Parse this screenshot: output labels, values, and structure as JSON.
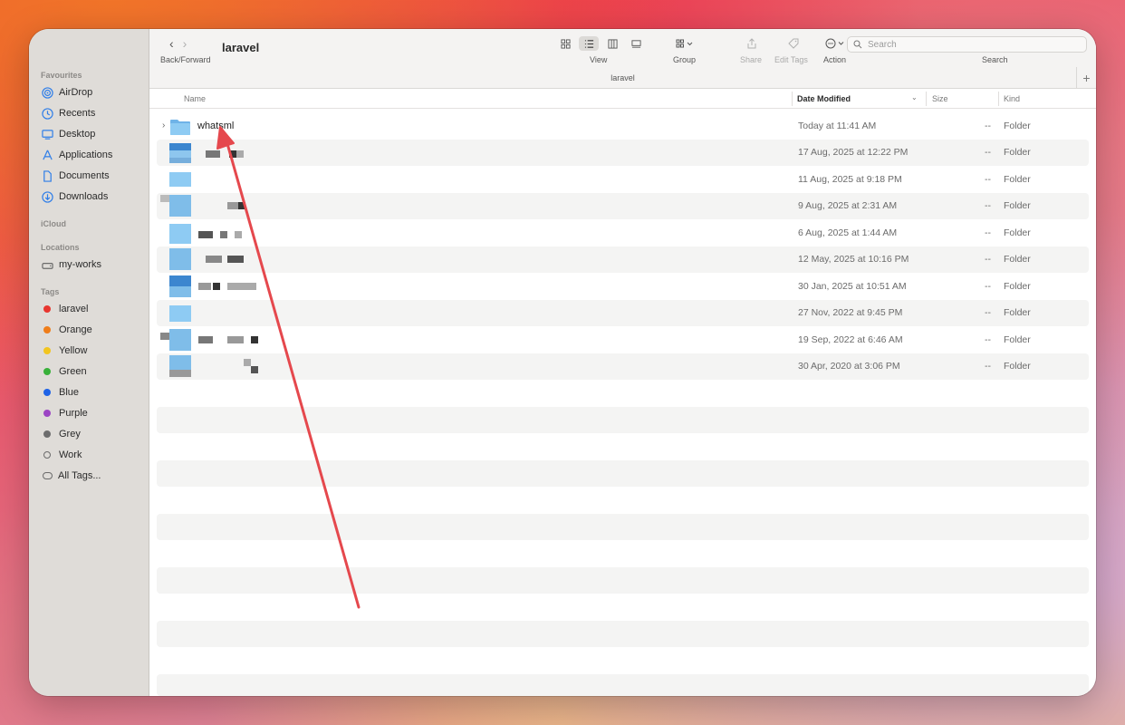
{
  "window": {
    "title": "laravel",
    "path_title": "laravel"
  },
  "toolbar": {
    "back_forward_label": "Back/Forward",
    "view_label": "View",
    "group_label": "Group",
    "share_label": "Share",
    "edit_tags_label": "Edit Tags",
    "action_label": "Action",
    "search_label": "Search",
    "search_placeholder": "Search",
    "add_tab": "+"
  },
  "sidebar": {
    "favourites_heading": "Favourites",
    "favourites": [
      {
        "label": "AirDrop",
        "icon": "airdrop-icon"
      },
      {
        "label": "Recents",
        "icon": "clock-icon"
      },
      {
        "label": "Desktop",
        "icon": "desktop-icon"
      },
      {
        "label": "Applications",
        "icon": "applications-icon"
      },
      {
        "label": "Documents",
        "icon": "document-icon"
      },
      {
        "label": "Downloads",
        "icon": "download-icon"
      }
    ],
    "icloud_heading": "iCloud",
    "locations_heading": "Locations",
    "locations": [
      {
        "label": "my-works",
        "icon": "drive-icon"
      }
    ],
    "tags_heading": "Tags",
    "tags": [
      {
        "label": "laravel",
        "color": "#e8362f"
      },
      {
        "label": "Orange",
        "color": "#ef7d1a"
      },
      {
        "label": "Yellow",
        "color": "#f2c51f"
      },
      {
        "label": "Green",
        "color": "#39b13a"
      },
      {
        "label": "Blue",
        "color": "#1f63e6"
      },
      {
        "label": "Purple",
        "color": "#9c45c4"
      },
      {
        "label": "Grey",
        "color": "#6d6d6d"
      },
      {
        "label": "Work",
        "color": "ring"
      },
      {
        "label": "All Tags...",
        "color": "pill"
      }
    ]
  },
  "columns": {
    "name": "Name",
    "date_modified": "Date Modified",
    "size": "Size",
    "kind": "Kind"
  },
  "files": [
    {
      "name": "whatsml",
      "date": "Today at 11:41 AM",
      "size": "--",
      "kind": "Folder"
    },
    {
      "name": "",
      "date": "17 Aug, 2025 at 12:22 PM",
      "size": "--",
      "kind": "Folder"
    },
    {
      "name": "",
      "date": "11 Aug, 2025 at 9:18 PM",
      "size": "--",
      "kind": "Folder"
    },
    {
      "name": "",
      "date": "9 Aug, 2025 at 2:31 AM",
      "size": "--",
      "kind": "Folder"
    },
    {
      "name": "",
      "date": "6 Aug, 2025 at 1:44 AM",
      "size": "--",
      "kind": "Folder"
    },
    {
      "name": "",
      "date": "12 May, 2025 at 10:16 PM",
      "size": "--",
      "kind": "Folder"
    },
    {
      "name": "",
      "date": "30 Jan, 2025 at 10:51 AM",
      "size": "--",
      "kind": "Folder"
    },
    {
      "name": "",
      "date": "27 Nov, 2022 at 9:45 PM",
      "size": "--",
      "kind": "Folder"
    },
    {
      "name": "",
      "date": "19 Sep, 2022 at 6:46 AM",
      "size": "--",
      "kind": "Folder"
    },
    {
      "name": "",
      "date": "30 Apr, 2020 at 3:06 PM",
      "size": "--",
      "kind": "Folder"
    }
  ],
  "colors": {
    "annotation_arrow": "#e5484d",
    "folder_blue": "#7dc0ee"
  }
}
